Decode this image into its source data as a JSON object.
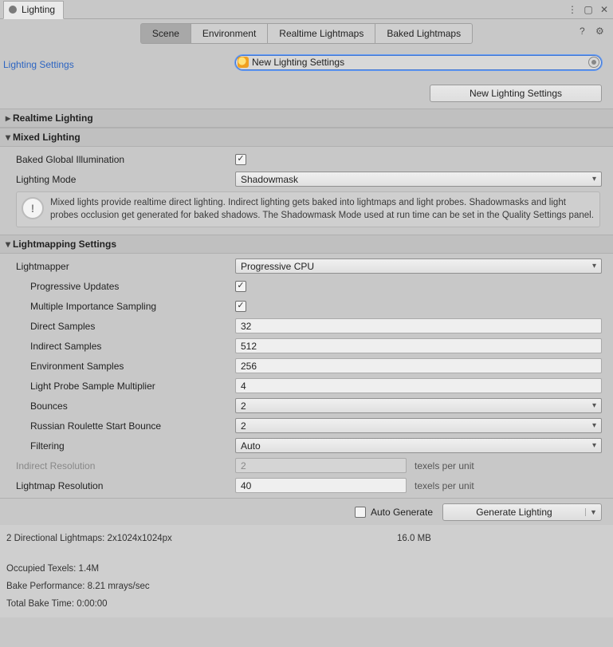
{
  "window": {
    "title": "Lighting"
  },
  "tabs": {
    "scene": "Scene",
    "environment": "Environment",
    "realtime": "Realtime Lightmaps",
    "baked": "Baked Lightmaps"
  },
  "header": {
    "lighting_settings_label": "Lighting Settings",
    "asset_name": "New Lighting Settings",
    "new_button": "New Lighting Settings"
  },
  "sections": {
    "realtime_lighting": "Realtime Lighting",
    "mixed_lighting": "Mixed Lighting",
    "lightmapping_settings": "Lightmapping Settings"
  },
  "mixed": {
    "baked_gi_label": "Baked Global Illumination",
    "lighting_mode_label": "Lighting Mode",
    "lighting_mode_value": "Shadowmask",
    "info": "Mixed lights provide realtime direct lighting. Indirect lighting gets baked into lightmaps and light probes. Shadowmasks and light probes occlusion get generated for baked shadows. The Shadowmask Mode used at run time can be set in the Quality Settings panel."
  },
  "lightmap": {
    "lightmapper_label": "Lightmapper",
    "lightmapper_value": "Progressive CPU",
    "progressive_updates_label": "Progressive Updates",
    "mis_label": "Multiple Importance Sampling",
    "direct_samples_label": "Direct Samples",
    "direct_samples_value": "32",
    "indirect_samples_label": "Indirect Samples",
    "indirect_samples_value": "512",
    "env_samples_label": "Environment Samples",
    "env_samples_value": "256",
    "lp_multiplier_label": "Light Probe Sample Multiplier",
    "lp_multiplier_value": "4",
    "bounces_label": "Bounces",
    "bounces_value": "2",
    "rr_label": "Russian Roulette Start Bounce",
    "rr_value": "2",
    "filtering_label": "Filtering",
    "filtering_value": "Auto",
    "indirect_res_label": "Indirect Resolution",
    "indirect_res_value": "2",
    "lightmap_res_label": "Lightmap Resolution",
    "lightmap_res_value": "40",
    "texels_suffix": "texels per unit"
  },
  "footer": {
    "auto_generate": "Auto Generate",
    "generate_lighting": "Generate Lighting"
  },
  "stats": {
    "line1a": "2 Directional Lightmaps: 2x1024x1024px",
    "line1b": "16.0 MB",
    "occupied": "Occupied Texels: 1.4M",
    "perf": "Bake Performance: 8.21 mrays/sec",
    "time": "Total Bake Time: 0:00:00"
  }
}
